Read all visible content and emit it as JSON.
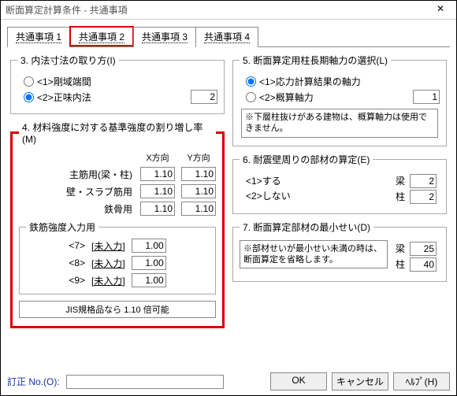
{
  "title": "断面算定計算条件 - 共通事項",
  "tabs": [
    "共通事項 1",
    "共通事項 2",
    "共通事項 3",
    "共通事項 4"
  ],
  "active_tab": 1,
  "sec3": {
    "title": "3. 内法寸法の取り方(I)",
    "opt1": "<1>剛域端間",
    "opt2": "<2>正味内法",
    "val": "2"
  },
  "sec4": {
    "title": "4. 材料強度に対する基準強度の割り増し率(M)",
    "xh": "X方向",
    "yh": "Y方向",
    "r1": "主筋用(梁・柱)",
    "r1x": "1.10",
    "r1y": "1.10",
    "r2": "壁・スラブ筋用",
    "r2x": "1.10",
    "r2y": "1.10",
    "r3": "鉄骨用",
    "r3x": "1.10",
    "r3y": "1.10",
    "sub_title": "鉄筋強度入力用",
    "s7": "<7>",
    "s7l": "[未入力]",
    "s7v": "1.00",
    "s8": "<8>",
    "s8l": "[未入力]",
    "s8v": "1.00",
    "s9": "<9>",
    "s9l": "[未入力]",
    "s9v": "1.00",
    "jis": "JIS規格品なら 1.10 倍可能"
  },
  "sec5": {
    "title": "5. 断面算定用柱長期軸力の選択(L)",
    "opt1": "<1>応力計算結果の軸力",
    "opt2": "<2>概算軸力",
    "val": "1",
    "note": "※下層柱抜けがある建物は、概算軸力は使用できません。"
  },
  "sec6": {
    "title": "6. 耐震壁周りの部材の算定(E)",
    "opt1": "<1>する",
    "opt2": "<2>しない",
    "b_lbl": "梁",
    "b_val": "2",
    "c_lbl": "柱",
    "c_val": "2"
  },
  "sec7": {
    "title": "7. 断面算定部材の最小せい(D)",
    "note": "※部材せいが最小せい未満の時は、断面算定を省略します。",
    "b_lbl": "梁",
    "b_val": "25",
    "c_lbl": "柱",
    "c_val": "40"
  },
  "footer": {
    "label": "訂正 No.(O):",
    "ok": "OK",
    "cancel": "キャンセル",
    "help": "ﾍﾙﾌﾟ(H)"
  }
}
